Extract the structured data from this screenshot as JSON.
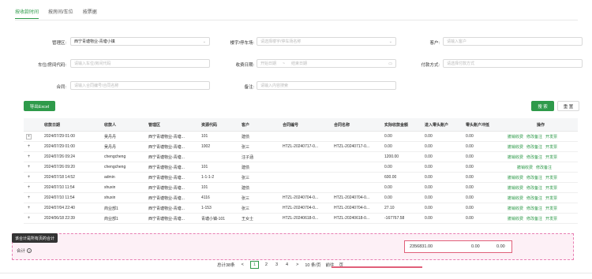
{
  "tabs": [
    "按收款时间",
    "按房间/车位",
    "按票据"
  ],
  "filters": {
    "mgmt_area": {
      "label": "管理区:",
      "value": "西宁青塘物业-青塘小镇"
    },
    "building": {
      "label": "楼宇/停车场:",
      "placeholder": "请选择楼宇/停车场名称"
    },
    "customer": {
      "label": "客户:",
      "placeholder": "请输入客户"
    },
    "room_code": {
      "label": "车位/房间代码:",
      "placeholder": "请输入车位/房间代码"
    },
    "date": {
      "label": "收费日期:",
      "start_placeholder": "开始日期",
      "separator": "~",
      "end_placeholder": "结束日期"
    },
    "pay_method": {
      "label": "付款方式:",
      "placeholder": "请选择付款方式"
    },
    "contract": {
      "label": "合同:",
      "placeholder": "请输入合同编号/合同名称"
    },
    "remark": {
      "label": "备注:",
      "placeholder": "请输入内容搜索"
    }
  },
  "buttons": {
    "export": "导出Excel",
    "search": "搜 索",
    "reset": "重 置"
  },
  "columns": [
    "收款日期",
    "收款人",
    "管理区",
    "资源代码",
    "客户",
    "合同编号",
    "合同名称",
    "实际收款金额",
    "进入零头账户",
    "零头账户冲抵",
    "操作"
  ],
  "rows": [
    {
      "exp": "+",
      "date": "2024/07/29 01:00",
      "payee": "吴丹丹",
      "area": "西宁青塘物业-青塘...",
      "res": "101",
      "cust": "建债",
      "cno": "",
      "cname": "",
      "amt": "0.00",
      "in": "0.00",
      "off": "0.00",
      "ops": [
        "撤销收费",
        "修改备注",
        "开发票"
      ]
    },
    {
      "exp": "+",
      "date": "2024/07/29 01:00",
      "payee": "吴丹丹",
      "area": "西宁青塘物业-青塘...",
      "res": "1002",
      "cust": "张三",
      "cno": "HTZL-20240717-0...",
      "cname": "HTZL-20240717-0...",
      "amt": "0.00",
      "in": "0.00",
      "off": "0.00",
      "ops": [
        "撤销收费",
        "修改备注",
        "开发票"
      ]
    },
    {
      "exp": "+",
      "date": "2024/07/26 09:24",
      "payee": "chengcheng",
      "area": "西宁青塘物业-青塘...",
      "res": "",
      "cust": "汪子涵",
      "cno": "",
      "cname": "",
      "amt": "1200.00",
      "in": "0.00",
      "off": "0.00",
      "ops": [
        "撤销收费",
        "修改备注",
        "开发票"
      ]
    },
    {
      "exp": "+",
      "date": "2024/07/26 09:20",
      "payee": "chengcheng",
      "area": "西宁青塘物业-青塘...",
      "res": "101",
      "cust": "建债",
      "cno": "",
      "cname": "",
      "amt": "0.00",
      "in": "0.00",
      "off": "0.00",
      "ops": [
        "撤销收费",
        "修改备注"
      ]
    },
    {
      "exp": "+",
      "date": "2024/07/18 14:52",
      "payee": "admin",
      "area": "西宁青塘物业-青塘...",
      "res": "1-1-1-2",
      "cust": "张三",
      "cno": "",
      "cname": "",
      "amt": "600.00",
      "in": "0.00",
      "off": "0.00",
      "ops": [
        "撤销收费",
        "修改备注",
        "开发票"
      ]
    },
    {
      "exp": "+",
      "date": "2024/07/10 11:54",
      "payee": "shuxin",
      "area": "西宁青塘物业-青塘...",
      "res": "101",
      "cust": "建债",
      "cno": "",
      "cname": "",
      "amt": "0.00",
      "in": "0.00",
      "off": "0.00",
      "ops": [
        "撤销收费",
        "修改备注",
        "开发票"
      ]
    },
    {
      "exp": "+",
      "date": "2024/07/10 11:54",
      "payee": "shuxin",
      "area": "西宁青塘物业-青塘...",
      "res": "4116",
      "cust": "张三",
      "cno": "HTZL-20240704-0...",
      "cname": "HTZL-20240704-0...",
      "amt": "0.00",
      "in": "0.00",
      "off": "0.00",
      "ops": [
        "撤销收费",
        "修改备注",
        "开发票"
      ]
    },
    {
      "exp": "+",
      "date": "2024/07/04 22:40",
      "payee": "商业部1",
      "area": "西宁青塘物业-青塘...",
      "res": "1-153",
      "cust": "张三",
      "cno": "HTZL-20240704-0...",
      "cname": "HTZL-20240704-0...",
      "amt": "27.10",
      "in": "0.00",
      "off": "0.00",
      "ops": [
        "撤销收费",
        "修改备注",
        "开发票"
      ]
    },
    {
      "exp": "+",
      "date": "2024/06/18 22:39",
      "payee": "商业部1",
      "area": "西宁青塘物业-青塘...",
      "res": "青塘小镇-101",
      "cust": "王女士",
      "cno": "HTZL-20240618-0...",
      "cname": "HTZL-20240618-0...",
      "amt": "-167767.58",
      "in": "0.00",
      "off": "0.00",
      "ops": [
        "撤销收费",
        "修改备注",
        "开发票"
      ]
    }
  ],
  "summary": {
    "label": "合计",
    "amount": "2356831.00",
    "in": "0.00",
    "off": "0.00",
    "tooltip": "该合计是所有页的合计"
  },
  "pager": {
    "total": "总计38条",
    "pages": [
      "1",
      "2",
      "3",
      "4"
    ],
    "next": ">",
    "size": "10 条/页",
    "goto": "前往",
    "page_input": "页"
  },
  "colors": {
    "accent": "#2e9a4a",
    "highlight": "#e0607a"
  }
}
